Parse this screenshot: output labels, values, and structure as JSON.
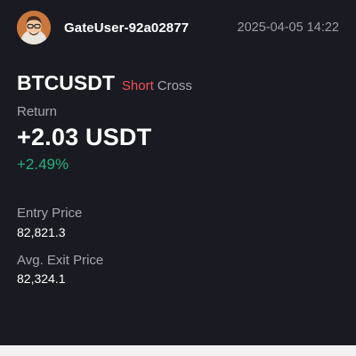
{
  "header": {
    "avatar_icon": "avatar-portrait",
    "username": "GateUser-92a02877",
    "timestamp": "2025-04-05 14:22"
  },
  "position": {
    "pair": "BTCUSDT",
    "side": "Short",
    "margin_mode": "Cross"
  },
  "return": {
    "label": "Return",
    "value": "+2.03 USDT",
    "percent": "+2.49%"
  },
  "entry": {
    "label": "Entry Price",
    "value": "82,821.3"
  },
  "exit": {
    "label": "Avg. Exit Price",
    "value": "82,324.1"
  },
  "colors": {
    "background": "#1a1b22",
    "short": "#f0505a",
    "profit": "#26b27a",
    "muted": "#a4a6b0"
  }
}
